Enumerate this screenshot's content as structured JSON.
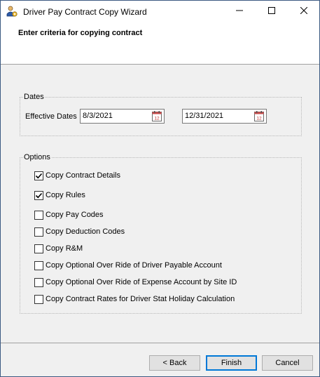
{
  "window": {
    "title": "Driver Pay Contract Copy Wizard",
    "icon": "user-settings-icon",
    "controls": [
      "minimize-icon",
      "maximize-icon",
      "close-icon"
    ]
  },
  "header": {
    "title": "Enter criteria for copying contract"
  },
  "dates_group": {
    "legend": "Dates",
    "effective_label": "Effective Dates",
    "start_date": "8/3/2021",
    "end_date": "12/31/2021",
    "calendar_icon": "calendar-icon"
  },
  "options_group": {
    "legend": "Options",
    "items": [
      {
        "label": "Copy Contract Details",
        "checked": true
      },
      {
        "label": "Copy Rules",
        "checked": true
      },
      {
        "label": "Copy Pay Codes",
        "checked": false
      },
      {
        "label": "Copy Deduction Codes",
        "checked": false
      },
      {
        "label": "Copy R&M",
        "checked": false
      },
      {
        "label": "Copy Optional Over Ride of Driver Payable Account",
        "checked": false
      },
      {
        "label": "Copy Optional Over Ride of Expense Account by Site ID",
        "checked": false
      },
      {
        "label": "Copy Contract Rates for Driver Stat Holiday Calculation",
        "checked": false
      }
    ]
  },
  "footer": {
    "back_label": "< Back",
    "finish_label": "Finish",
    "cancel_label": "Cancel"
  },
  "colors": {
    "accent": "#0078d7",
    "window_bg": "#f0f0f0",
    "panel_bg": "#ffffff"
  }
}
